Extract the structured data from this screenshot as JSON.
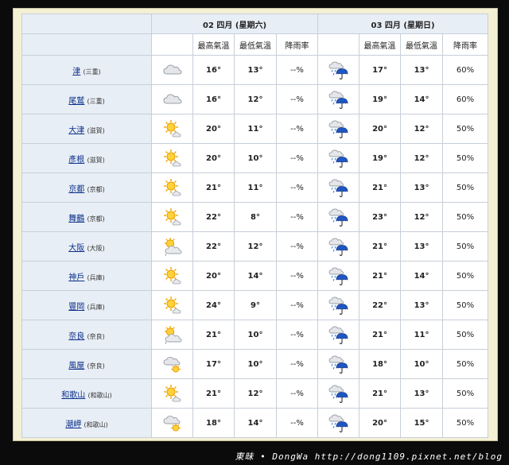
{
  "days": [
    {
      "label": "02 四月 (星期六)"
    },
    {
      "label": "03 四月 (星期日)"
    }
  ],
  "columns": {
    "high": "最高氣溫",
    "low": "最低氣溫",
    "rain": "降雨率"
  },
  "rows": [
    {
      "name": "津",
      "pref": "(三重)",
      "d1_icon": "cloudy-icon",
      "d1_high": "16°",
      "d1_low": "13°",
      "d1_rain": "--%",
      "d2_icon": "cloud-rain-umbrella-icon",
      "d2_high": "17°",
      "d2_low": "13°",
      "d2_rain": "60%"
    },
    {
      "name": "尾鷲",
      "pref": "(三重)",
      "d1_icon": "cloudy-icon",
      "d1_high": "16°",
      "d1_low": "12°",
      "d1_rain": "--%",
      "d2_icon": "cloud-rain-umbrella-icon",
      "d2_high": "19°",
      "d2_low": "14°",
      "d2_rain": "60%"
    },
    {
      "name": "大津",
      "pref": "(滋賀)",
      "d1_icon": "sunny-cloud-icon",
      "d1_high": "20°",
      "d1_low": "11°",
      "d1_rain": "--%",
      "d2_icon": "cloud-rain-umbrella-icon",
      "d2_high": "20°",
      "d2_low": "12°",
      "d2_rain": "50%"
    },
    {
      "name": "彥根",
      "pref": "(滋賀)",
      "d1_icon": "sunny-cloud-icon",
      "d1_high": "20°",
      "d1_low": "10°",
      "d1_rain": "--%",
      "d2_icon": "cloud-rain-umbrella-icon",
      "d2_high": "19°",
      "d2_low": "12°",
      "d2_rain": "50%"
    },
    {
      "name": "京都",
      "pref": "(京都)",
      "d1_icon": "sunny-cloud-icon",
      "d1_high": "21°",
      "d1_low": "11°",
      "d1_rain": "--%",
      "d2_icon": "cloud-rain-umbrella-icon",
      "d2_high": "21°",
      "d2_low": "13°",
      "d2_rain": "50%"
    },
    {
      "name": "舞鶴",
      "pref": "(京都)",
      "d1_icon": "sunny-cloud-icon",
      "d1_high": "22°",
      "d1_low": "8°",
      "d1_rain": "--%",
      "d2_icon": "cloud-rain-umbrella-icon",
      "d2_high": "23°",
      "d2_low": "12°",
      "d2_rain": "50%"
    },
    {
      "name": "大阪",
      "pref": "(大阪)",
      "d1_icon": "sun-behind-cloud-icon",
      "d1_high": "22°",
      "d1_low": "12°",
      "d1_rain": "--%",
      "d2_icon": "cloud-rain-umbrella-icon",
      "d2_high": "21°",
      "d2_low": "13°",
      "d2_rain": "50%"
    },
    {
      "name": "神戶",
      "pref": "(兵庫)",
      "d1_icon": "sunny-cloud-icon",
      "d1_high": "20°",
      "d1_low": "14°",
      "d1_rain": "--%",
      "d2_icon": "cloud-rain-umbrella-icon",
      "d2_high": "21°",
      "d2_low": "14°",
      "d2_rain": "50%"
    },
    {
      "name": "豐岡",
      "pref": "(兵庫)",
      "d1_icon": "sunny-cloud-icon",
      "d1_high": "24°",
      "d1_low": "9°",
      "d1_rain": "--%",
      "d2_icon": "cloud-rain-umbrella-icon",
      "d2_high": "22°",
      "d2_low": "13°",
      "d2_rain": "50%"
    },
    {
      "name": "奈良",
      "pref": "(奈良)",
      "d1_icon": "sun-behind-cloud-icon",
      "d1_high": "21°",
      "d1_low": "10°",
      "d1_rain": "--%",
      "d2_icon": "cloud-rain-umbrella-icon",
      "d2_high": "21°",
      "d2_low": "11°",
      "d2_rain": "50%"
    },
    {
      "name": "風屋",
      "pref": "(奈良)",
      "d1_icon": "cloud-sun-icon",
      "d1_high": "17°",
      "d1_low": "10°",
      "d1_rain": "--%",
      "d2_icon": "cloud-rain-umbrella-icon",
      "d2_high": "18°",
      "d2_low": "10°",
      "d2_rain": "50%"
    },
    {
      "name": "和歌山",
      "pref": "(和歌山)",
      "d1_icon": "sunny-cloud-icon",
      "d1_high": "21°",
      "d1_low": "12°",
      "d1_rain": "--%",
      "d2_icon": "cloud-rain-umbrella-icon",
      "d2_high": "21°",
      "d2_low": "13°",
      "d2_rain": "50%"
    },
    {
      "name": "潮岬",
      "pref": "(和歌山)",
      "d1_icon": "cloud-sun-icon",
      "d1_high": "18°",
      "d1_low": "14°",
      "d1_rain": "--%",
      "d2_icon": "cloud-rain-umbrella-icon",
      "d2_high": "20°",
      "d2_low": "15°",
      "d2_rain": "50%"
    }
  ],
  "watermark": "東昧 • DongWa http://dong1109.pixnet.net/blog",
  "colors": {
    "high": "#d01818",
    "low": "#1f5fb8",
    "header_bg": "#e8eef5",
    "frame_bg": "#f4f0d4"
  }
}
